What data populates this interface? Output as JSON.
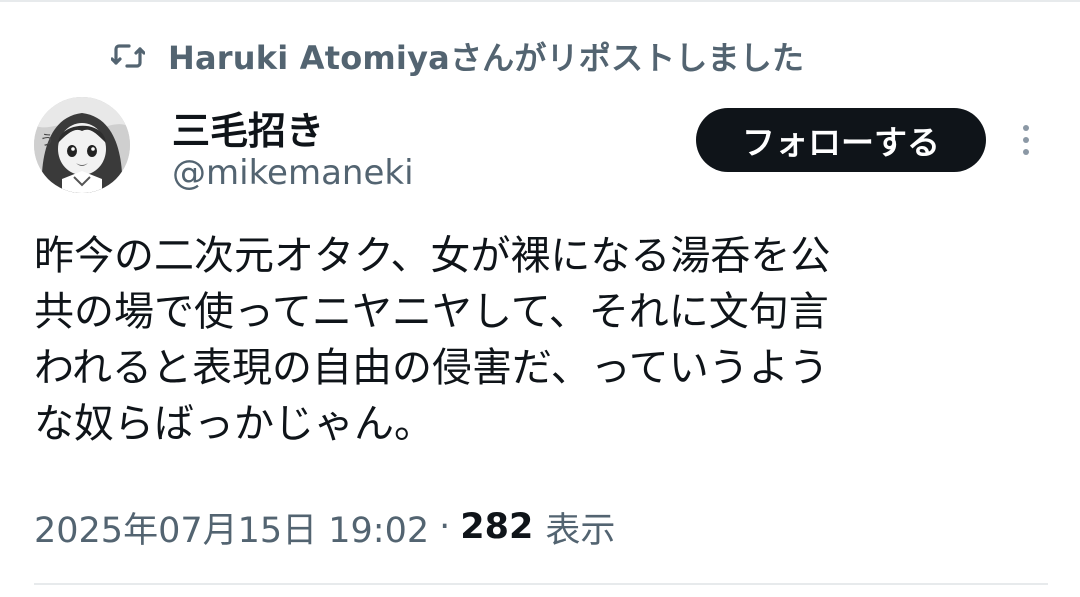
{
  "repost": {
    "icon": "repost-icon",
    "label": "Haruki Atomiyaさんがリポストしました"
  },
  "author": {
    "avatar_icon": "avatar-anime-girl",
    "name": "三毛招き",
    "handle": "@mikemaneki"
  },
  "actions": {
    "follow_label": "フォローする",
    "more_icon": "more-vertical-icon"
  },
  "tweet": {
    "text": "昨今の二次元オタク、女が裸になる湯呑を公\n共の場で使ってニヤニヤして、それに文句言\nわれると表現の自由の侵害だ、っていうよう\nな奴らばっかじゃん。"
  },
  "meta": {
    "timestamp": "2025年07月15日 19:02",
    "separator": "·",
    "views_count": "282",
    "views_label": "表示"
  },
  "colors": {
    "text_primary": "#0f1419",
    "text_secondary": "#536471",
    "button_bg": "#0f1419",
    "divider": "#e7eaec"
  }
}
